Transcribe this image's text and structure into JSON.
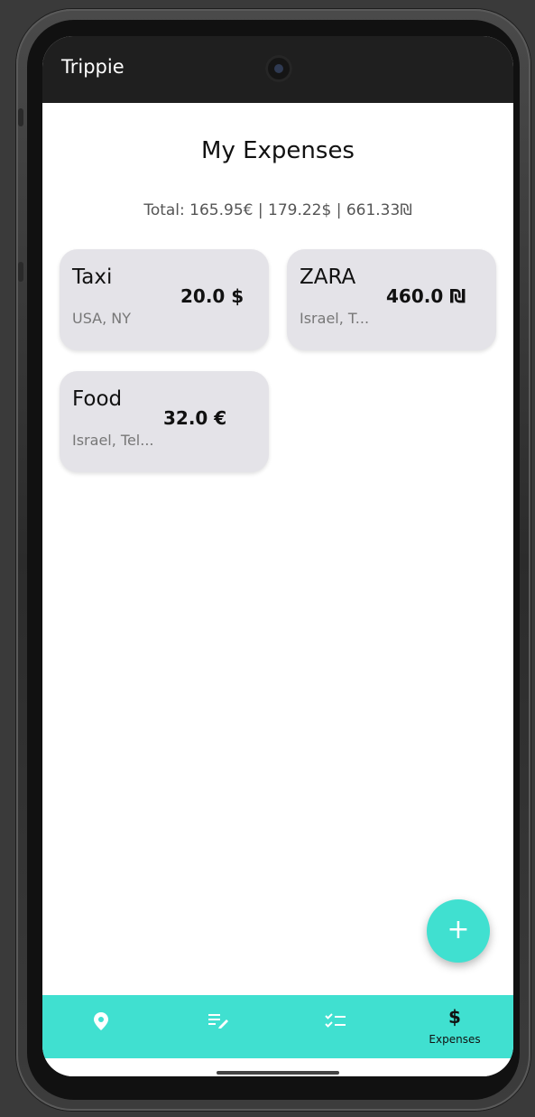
{
  "app_bar": {
    "title": "Trippie"
  },
  "page": {
    "title": "My Expenses",
    "total": "Total: 165.95€ | 179.22$ | 661.33₪"
  },
  "expenses": [
    {
      "title": "Taxi",
      "amount": "20.0 $",
      "location": "USA, NY"
    },
    {
      "title": "ZARA",
      "amount": "460.0 ₪",
      "location": "Israel, T..."
    },
    {
      "title": "Food",
      "amount": "32.0 €",
      "location": "Israel, Tel..."
    }
  ],
  "fab": {
    "icon": "plus-icon",
    "label": "+"
  },
  "bottom_nav": {
    "items": [
      {
        "icon": "location-pin-icon",
        "glyph": "📍"
      },
      {
        "icon": "edit-notes-icon",
        "glyph": "≡"
      },
      {
        "icon": "checklist-icon",
        "glyph": "☑"
      },
      {
        "icon": "dollar-icon",
        "glyph": "$",
        "label": "Expenses",
        "active": true
      }
    ]
  },
  "colors": {
    "accent": "#40e0d0",
    "app_bar": "#1f1f1f",
    "card": "#e4e3e8"
  }
}
